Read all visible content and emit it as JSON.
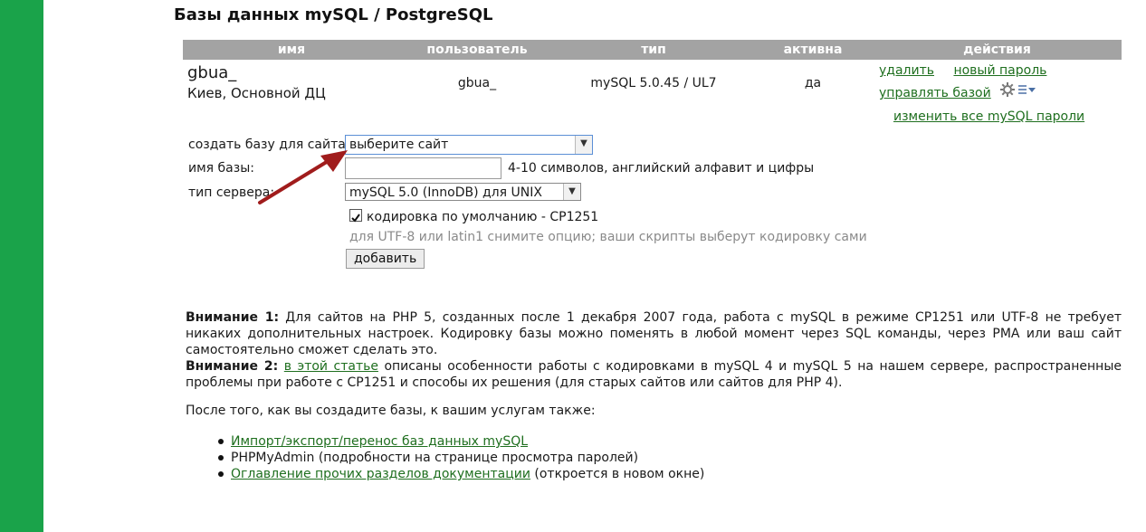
{
  "page": {
    "title": "Базы данных mySQL / PostgreSQL"
  },
  "table": {
    "headers": [
      "имя",
      "пользователь",
      "тип",
      "активна",
      "действия"
    ],
    "row": {
      "name": "gbua_",
      "location": "Киев, Основной ДЦ",
      "user": "gbua_",
      "type": "mySQL 5.0.45 / UL7",
      "active": "да",
      "actions": {
        "delete": "удалить",
        "new_password": "новый пароль",
        "manage": "управлять базой"
      }
    },
    "change_all_passwords": "изменить все mySQL пароли"
  },
  "form": {
    "site_label": "создать базу для сайта:",
    "site_select": "выберите сайт",
    "name_label": "имя базы:",
    "name_value": "",
    "name_hint": "4-10 символов, английский алфавит и цифры",
    "server_label": "тип сервера:",
    "server_select": "mySQL 5.0 (InnoDB) для UNIX",
    "encoding_label": "кодировка по умолчанию - CP1251",
    "encoding_checked": true,
    "encoding_hint": "для UTF-8 или latin1 снимите опцию; ваши скрипты выберут кодировку сами",
    "add_button": "добавить"
  },
  "notices": {
    "n1_bold": "Внимание 1:",
    "n1_text": " Для сайтов на PHP 5, созданных после 1 декабря 2007 года, работа с mySQL в режиме CP1251 или UTF-8 не требует никаких дополнительных настроек. Кодировку базы можно поменять в любой момент через SQL команды, через PMA или ваш сайт самостоятельно сможет сделать это.",
    "n2_bold": "Внимание 2:",
    "n2_link": "в этой статье",
    "n2_text": " описаны особенности работы с кодировками в mySQL 4 и mySQL 5 на нашем сервере, распространенные проблемы при работе с CP1251 и способы их решения (для старых сайтов или сайтов для PHP 4)."
  },
  "after": {
    "text": "После того, как вы создадите базы, к вашим услугам также:",
    "items": [
      {
        "link": "Импорт/экспорт/перенос баз данных mySQL",
        "text": ""
      },
      {
        "link": "",
        "text": "PHPMyAdmin (подробности на странице просмотра паролей)"
      },
      {
        "link": "Оглавление прочих разделов документации",
        "text": " (откроется в новом окне)"
      }
    ]
  },
  "colors": {
    "brand_green": "#1aa34a",
    "link_green": "#1f6f1f",
    "header_gray": "#a3a3a3",
    "arrow_red": "#a01c1c"
  },
  "icons": {
    "gear": "gear-icon",
    "dropdown": "chevron-down-icon",
    "arrow": "annotation-arrow"
  }
}
